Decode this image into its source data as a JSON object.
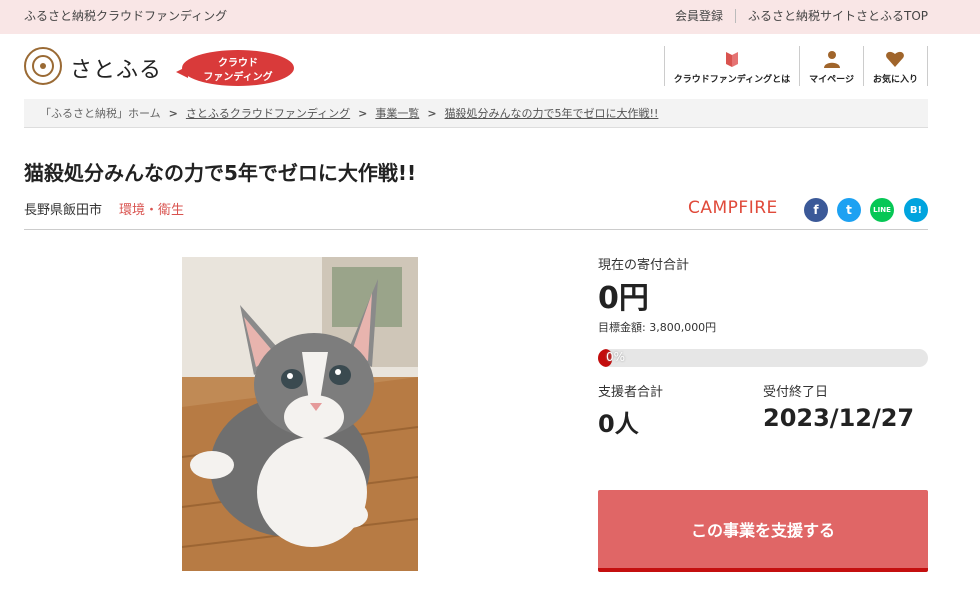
{
  "topbar": {
    "tagline": "ふるさと納税クラウドファンディング",
    "register": "会員登録",
    "site_top": "ふるさと納税サイトさとふるTOP"
  },
  "header": {
    "logo_text": "さとふる",
    "cf_badge": [
      "クラウド",
      "ファンディング"
    ],
    "nav": [
      {
        "label": "クラウドファンディングとは",
        "icon": "book-icon"
      },
      {
        "label": "マイページ",
        "icon": "user-icon"
      },
      {
        "label": "お気に入り",
        "icon": "heart-icon"
      }
    ]
  },
  "breadcrumb": [
    "「ふるさと納税」ホーム",
    "さとふるクラウドファンディング",
    "事業一覧",
    "猫殺処分みんなの力で5年でゼロに大作戦!!"
  ],
  "project": {
    "title": "猫殺処分みんなの力で5年でゼロに大作戦!!",
    "location": "長野県飯田市",
    "category": "環境・衛生",
    "platform": "CAMPFIRE",
    "share": [
      "f",
      "t",
      "LINE",
      "B!"
    ]
  },
  "stats": {
    "current_label": "現在の寄付合計",
    "current_value": "0円",
    "goal": "目標金額: 3,800,000円",
    "progress_label": "0%",
    "progress_fraction": 0,
    "supporters_label": "支援者合計",
    "supporters_value": "0人",
    "deadline_label": "受付終了日",
    "deadline_value": "2023/12/27"
  },
  "cta": {
    "support_label": "この事業を支援する"
  },
  "colors": {
    "topbar_bg": "#f9e6e6",
    "accent_red": "#d93a3a",
    "button": "#e06666",
    "progress_fill": "#c30d0d"
  }
}
